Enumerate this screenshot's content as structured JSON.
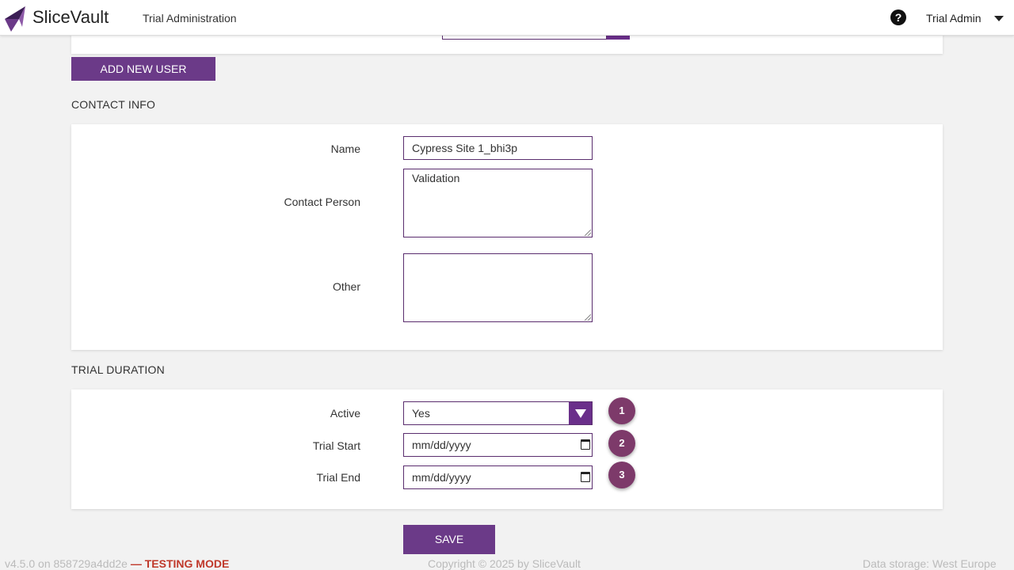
{
  "header": {
    "brand": "SliceVault",
    "section": "Trial Administration",
    "help_icon": "question-circle-icon",
    "user": "Trial Admin"
  },
  "toolbar": {
    "add_user_label": "ADD NEW USER"
  },
  "contact": {
    "heading": "CONTACT INFO",
    "name_label": "Name",
    "name_value": "Cypress Site 1_bhi3p",
    "contact_label": "Contact Person",
    "contact_value": "Validation",
    "other_label": "Other",
    "other_value": ""
  },
  "trial": {
    "heading": "TRIAL DURATION",
    "active_label": "Active",
    "active_value": "Yes",
    "start_label": "Trial Start",
    "start_placeholder": "mm/dd/yyyy",
    "end_label": "Trial End",
    "end_placeholder": "mm/dd/yyyy",
    "steps": [
      "1",
      "2",
      "3"
    ]
  },
  "actions": {
    "save_label": "SAVE"
  },
  "footer": {
    "version": "v4.5.0 on 858729a4dd2e",
    "mode": "— TESTING MODE",
    "copyright": "Copyright © 2025 by SliceVault",
    "storage": "Data storage: West Europe"
  },
  "colors": {
    "accent": "#6b3a88",
    "step_badge": "#7d3a6a",
    "testing_mode": "#c0392b"
  }
}
